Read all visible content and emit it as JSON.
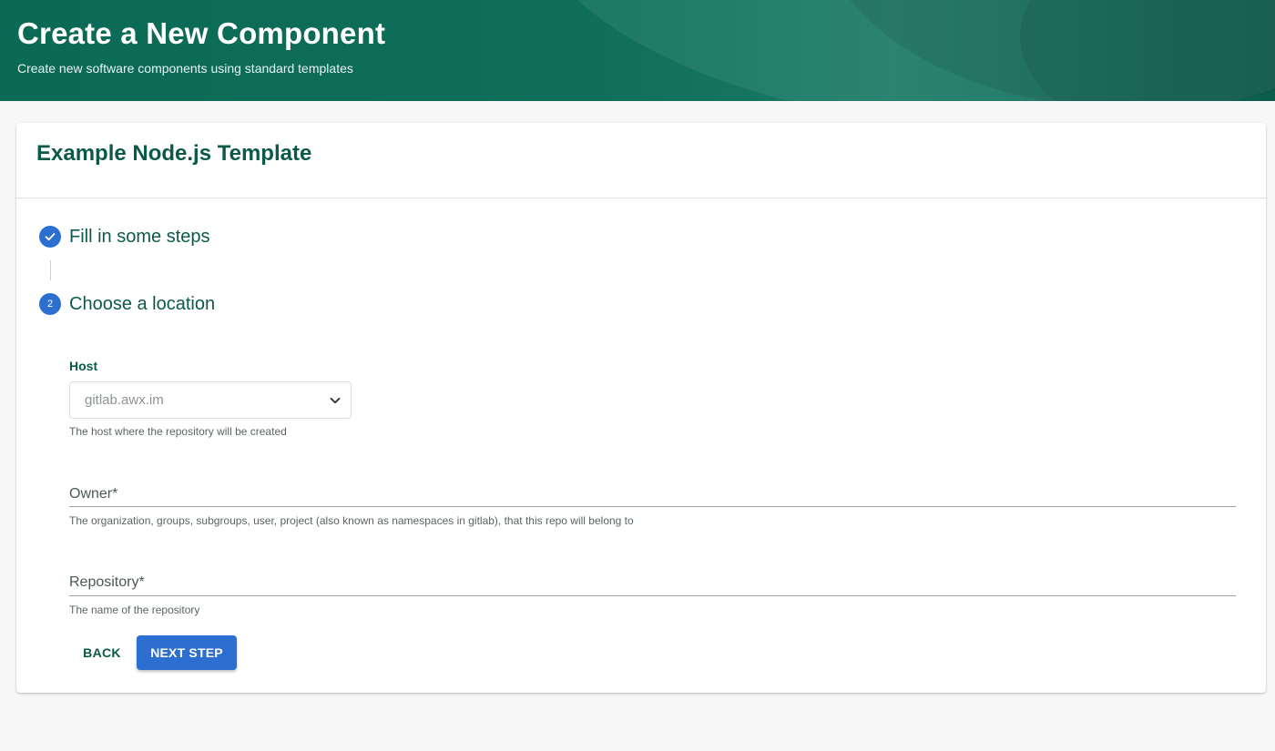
{
  "header": {
    "title": "Create a New Component",
    "subtitle": "Create new software components using standard templates"
  },
  "card": {
    "title": "Example Node.js Template"
  },
  "stepper": {
    "steps": [
      {
        "label": "Fill in some steps",
        "status": "completed",
        "icon": "check-icon"
      },
      {
        "label": "Choose a location",
        "status": "active",
        "number": "2"
      }
    ]
  },
  "form": {
    "host": {
      "label": "Host",
      "value": "gitlab.awx.im",
      "helper": "The host where the repository will be created"
    },
    "owner": {
      "label": "Owner*",
      "value": "",
      "helper": "The organization, groups, subgroups, user, project (also known as namespaces in gitlab), that this repo will belong to"
    },
    "repository": {
      "label": "Repository*",
      "value": "",
      "helper": "The name of the repository"
    }
  },
  "buttons": {
    "back": "BACK",
    "next": "NEXT STEP"
  },
  "colors": {
    "header_bg": "#0e6e59",
    "title_text": "#0b5a49",
    "primary": "#2d6fd1",
    "page_bg": "#f6f7f6"
  }
}
